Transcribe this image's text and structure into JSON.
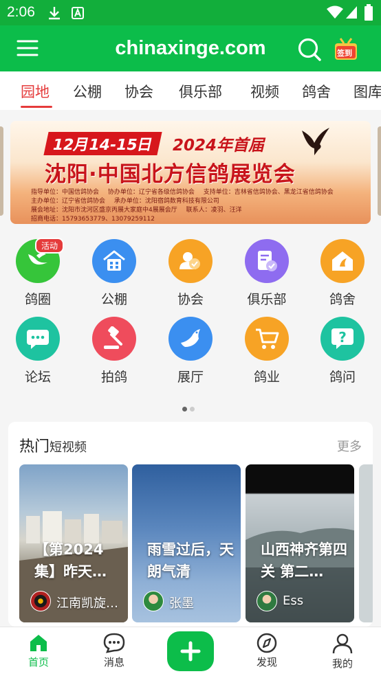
{
  "status_bar": {
    "time": "2:06"
  },
  "app_bar": {
    "site": "chinaxinge.com",
    "signin_label": "签到"
  },
  "tabs": [
    {
      "label": "园地",
      "active": true
    },
    {
      "label": "公棚"
    },
    {
      "label": "协会"
    },
    {
      "label": "俱乐部"
    },
    {
      "label": "视频"
    },
    {
      "label": "鸽舍"
    },
    {
      "label": "图库"
    }
  ],
  "banner": {
    "dates": "12月14-15日",
    "edition": "2024年首届",
    "title": "沈阳·中国北方信鸽展览会",
    "info": [
      "指导单位：中国信鸽协会",
      "协办单位：辽宁省各级信鸽协会",
      "支持单位：吉林省信鸽协会、黑龙江省信鸽协会",
      "主办单位：辽宁省信鸽协会",
      "承办单位：沈阳宿鸽数育科技有限公司",
      "展会地址：沈阳市沈河区盛京丙展大家庭中4展展会厅",
      "联系人：凌羽、汪洋",
      "招商电话：15793653779、13079259112"
    ]
  },
  "grid": {
    "items": [
      {
        "label": "鸽圈",
        "icon": "pigeon-circle-icon",
        "color": "#36c53a",
        "badge": "活动"
      },
      {
        "label": "公棚",
        "icon": "loft-building-icon",
        "color": "#3b8ff0"
      },
      {
        "label": "协会",
        "icon": "association-icon",
        "color": "#f7a325"
      },
      {
        "label": "俱乐部",
        "icon": "club-checklist-icon",
        "color": "#8e6cf0"
      },
      {
        "label": "鸽舍",
        "icon": "pigeon-house-icon",
        "color": "#f7a325"
      },
      {
        "label": "论坛",
        "icon": "forum-chat-icon",
        "color": "#1ec3a0"
      },
      {
        "label": "拍鸽",
        "icon": "auction-hammer-icon",
        "color": "#ef4c5c"
      },
      {
        "label": "展厅",
        "icon": "exhibition-pigeon-icon",
        "color": "#3b8ff0"
      },
      {
        "label": "鸽业",
        "icon": "shopping-cart-icon",
        "color": "#f7a325"
      },
      {
        "label": "鸽问",
        "icon": "question-icon",
        "color": "#1ec3a0"
      }
    ],
    "page_dots": 2,
    "active_dot": 1
  },
  "hot_videos": {
    "title": "热门",
    "subtitle": "短视频",
    "more": "更多",
    "videos": [
      {
        "title": "【第2024集】昨天…",
        "author": "江南凯旋…"
      },
      {
        "title": "雨雪过后，天朗气清",
        "author": "张墨"
      },
      {
        "title": "山西神齐第四关 第二…",
        "author": "Ess"
      }
    ]
  },
  "bottom_nav": [
    {
      "label": "首页",
      "icon": "home-icon",
      "active": true
    },
    {
      "label": "消息",
      "icon": "message-icon"
    },
    {
      "label": "",
      "icon": "add-icon"
    },
    {
      "label": "发现",
      "icon": "compass-icon"
    },
    {
      "label": "我的",
      "icon": "profile-icon"
    }
  ],
  "colors": {
    "brand_green": "#0cbd4a",
    "active_red": "#e53b3b"
  }
}
